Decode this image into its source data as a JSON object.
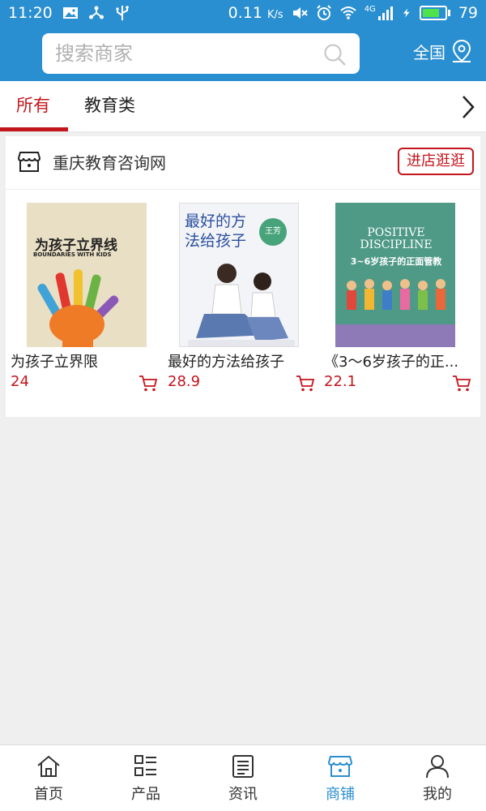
{
  "status_bar": {
    "time": "11:20",
    "network_speed": "0.11",
    "network_unit": "K/s",
    "network_type": "4G",
    "battery": "79"
  },
  "header": {
    "search_placeholder": "搜索商家",
    "region_label": "全国"
  },
  "tabs": [
    {
      "label": "所有",
      "active": true
    },
    {
      "label": "教育类",
      "active": false
    }
  ],
  "shop": {
    "name": "重庆教育咨询网",
    "visit_button": "进店逛逛"
  },
  "products": [
    {
      "name": "为孩子立界限",
      "price": "24",
      "cover_title": "为孩子立界线",
      "cover_subtitle": "BOUNDARIES WITH KIDS"
    },
    {
      "name": "最好的方法给孩子",
      "price": "28.9",
      "cover_title": "最好的方法给孩子",
      "cover_subtitle": "王芳"
    },
    {
      "name": "《3～6岁孩子的正...",
      "price": "22.1",
      "cover_title": "POSITIVE DISCIPLINE",
      "cover_subtitle": "3~6岁孩子的正面管教"
    }
  ],
  "bottom_nav": [
    {
      "label": "首页",
      "icon": "home-icon",
      "active": false
    },
    {
      "label": "产品",
      "icon": "list-icon",
      "active": false
    },
    {
      "label": "资讯",
      "icon": "news-icon",
      "active": false
    },
    {
      "label": "商铺",
      "icon": "shop-icon",
      "active": true
    },
    {
      "label": "我的",
      "icon": "user-icon",
      "active": false
    }
  ],
  "colors": {
    "brand_blue": "#2a8fd0",
    "accent_red": "#c4151c",
    "background": "#efefef"
  }
}
